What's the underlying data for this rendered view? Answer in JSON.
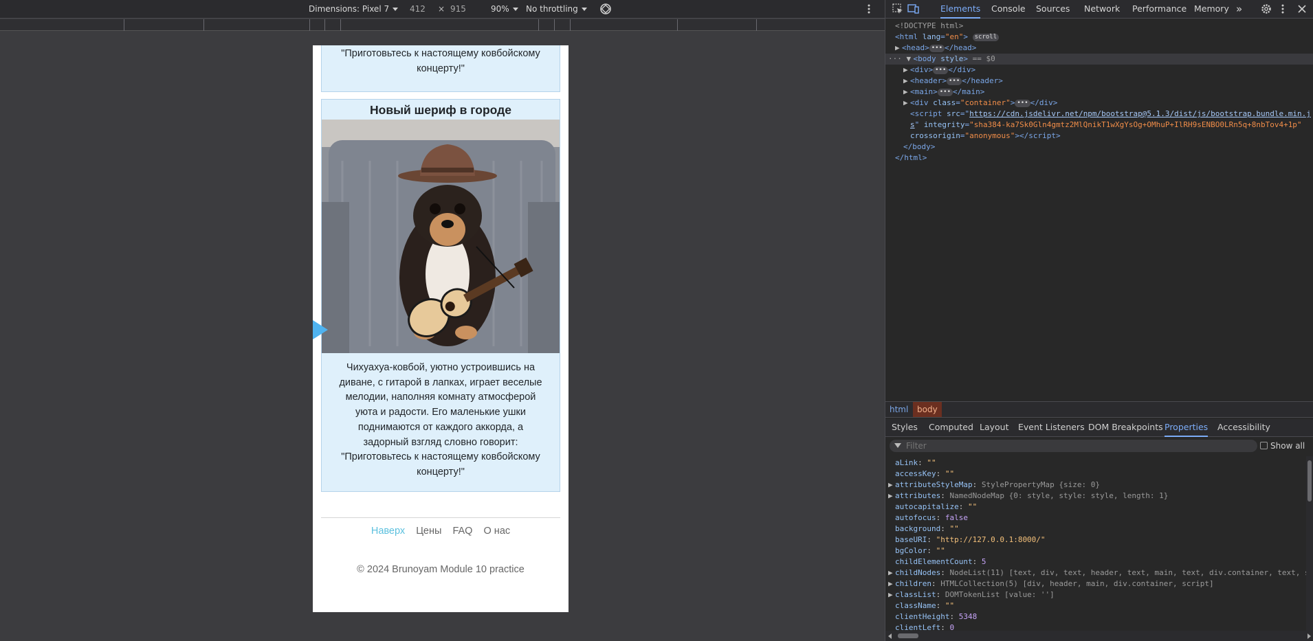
{
  "device_toolbar": {
    "dimensions_label": "Dimensions: Pixel 7",
    "width": "412",
    "times": "×",
    "height": "915",
    "zoom": "90%",
    "throttling": "No throttling"
  },
  "page": {
    "top_card_text": "\"Приготовьтесь к настоящему ковбойскому концерту!\"",
    "card_title": "Новый шериф в городе",
    "card_text": "Чихуахуа-ковбой, уютно устроившись на диване, с гитарой в лапках, играет веселые мелодии, наполняя комнату атмосферой уюта и радости. Его маленькие ушки поднимаются от каждого аккорда, а задорный взгляд словно говорит: \"Приготовьтесь к настоящему ковбойскому концерту!\"",
    "footer_links": [
      "Наверх",
      "Цены",
      "FAQ",
      "О нас"
    ],
    "copyright": "© 2024 Brunoyam Module 10 practice"
  },
  "devtools": {
    "tabs": [
      "Elements",
      "Console",
      "Sources",
      "Network",
      "Performance",
      "Memory"
    ],
    "active_tab": "Elements",
    "more_tabs": "»",
    "dom": {
      "doctype": "<!DOCTYPE html>",
      "html_open_tag": "html",
      "html_attr": "lang",
      "html_attr_val": "\"en\"",
      "scroll_badge": "scroll",
      "head": "head",
      "body_tag": "body",
      "body_attr": "style",
      "body_marker": "== $0",
      "div": "div",
      "header": "header",
      "main": "main",
      "container_attr": "class",
      "container_val": "\"container\"",
      "script_src_attr": "src",
      "script_src_part1": "https://cdn.jsdelivr.net/npm/bootstrap@5.1.3/dist/js/bootstrap.bundle.min.j",
      "script_src_part2": "s",
      "integrity_attr": "integrity",
      "integrity_val": "\"sha384-ka7Sk0Gln4gmtz2MlQnikT1wXgYsOg+OMhuP+IlRH9sENBO0LRn5q+8nbTov4+1p\"",
      "crossorigin_attr": "crossorigin",
      "crossorigin_val": "\"anonymous\"",
      "script": "script",
      "body_close": "</body>",
      "html_close": "</html>"
    },
    "breadcrumbs": [
      "html",
      "body"
    ],
    "subtabs": [
      "Styles",
      "Computed",
      "Layout",
      "Event Listeners",
      "DOM Breakpoints",
      "Properties",
      "Accessibility"
    ],
    "active_subtab": "Properties",
    "filter_placeholder": "Filter",
    "show_all_label": "Show all",
    "properties": [
      {
        "key": "aLink",
        "value": "\"\"",
        "type": "string",
        "expandable": false
      },
      {
        "key": "accessKey",
        "value": "\"\"",
        "type": "string",
        "expandable": false
      },
      {
        "key": "attributeStyleMap",
        "value": "StylePropertyMap {size: 0}",
        "type": "object",
        "expandable": true
      },
      {
        "key": "attributes",
        "value": "NamedNodeMap {0: style, style: style, length: 1}",
        "type": "object",
        "expandable": true
      },
      {
        "key": "autocapitalize",
        "value": "\"\"",
        "type": "string",
        "expandable": false
      },
      {
        "key": "autofocus",
        "value": "false",
        "type": "bool",
        "expandable": false
      },
      {
        "key": "background",
        "value": "\"\"",
        "type": "string",
        "expandable": false
      },
      {
        "key": "baseURI",
        "value": "\"http://127.0.0.1:8000/\"",
        "type": "string",
        "expandable": false
      },
      {
        "key": "bgColor",
        "value": "\"\"",
        "type": "string",
        "expandable": false
      },
      {
        "key": "childElementCount",
        "value": "5",
        "type": "number",
        "expandable": false
      },
      {
        "key": "childNodes",
        "value": "NodeList(11) [text, div, text, header, text, main, text, div.container, text, s",
        "type": "object",
        "expandable": true
      },
      {
        "key": "children",
        "value": "HTMLCollection(5) [div, header, main, div.container, script]",
        "type": "object",
        "expandable": true
      },
      {
        "key": "classList",
        "value": "DOMTokenList [value: '']",
        "type": "object",
        "expandable": true
      },
      {
        "key": "className",
        "value": "\"\"",
        "type": "string",
        "expandable": false
      },
      {
        "key": "clientHeight",
        "value": "5348",
        "type": "number",
        "expandable": false
      },
      {
        "key": "clientLeft",
        "value": "0",
        "type": "number",
        "expandable": false
      }
    ]
  },
  "colors": {
    "accent_blue": "#7cacf8",
    "card_bg": "#dff0fb",
    "active_link": "#5bc0de",
    "selected_crumb": "#6b2f20"
  }
}
